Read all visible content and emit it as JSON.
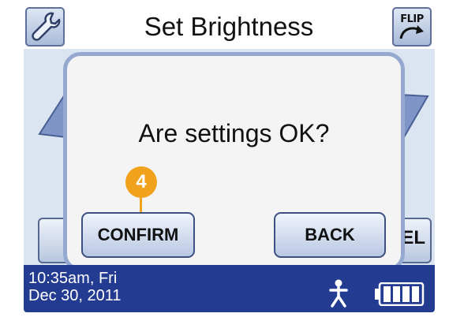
{
  "header": {
    "title": "Set Brightness",
    "flip_label": "FLIP",
    "settings_icon": "wrench-icon",
    "flip_icon": "flip-arrow-icon"
  },
  "background": {
    "right_button_partial_label": "EL"
  },
  "dialog": {
    "question": "Are settings OK?",
    "confirm_label": "CONFIRM",
    "back_label": "BACK",
    "callout_number": "4"
  },
  "status": {
    "time_line1": "10:35am, Fri",
    "time_line2": "Dec 30, 2011",
    "person_icon": "person-icon",
    "battery_icon": "battery-icon"
  },
  "colors": {
    "footer_bg": "#233b91",
    "dialog_border": "#95a8d0",
    "callout": "#f0a21c"
  }
}
